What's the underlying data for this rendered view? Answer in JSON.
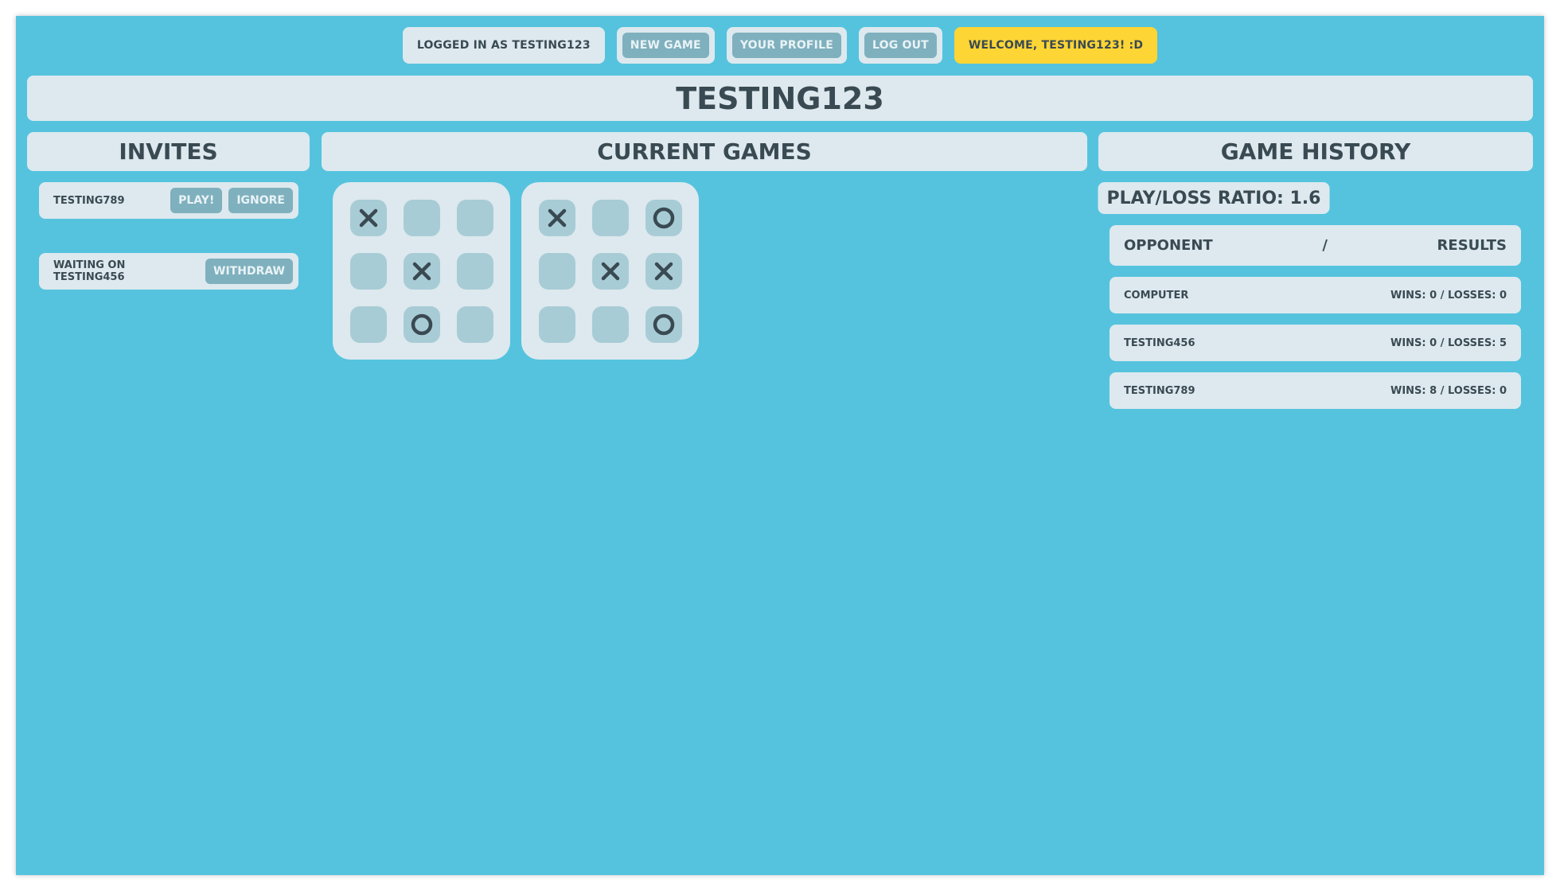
{
  "nav": {
    "logged_in": "LOGGED IN AS TESTING123",
    "new_game": "NEW GAME",
    "your_profile": "YOUR PROFILE",
    "log_out": "LOG OUT",
    "welcome": "WELCOME, TESTING123! :D"
  },
  "profile": {
    "title": "TESTING123"
  },
  "invites": {
    "heading": "INVITES",
    "items": [
      {
        "name": "TESTING789",
        "play": "PLAY!",
        "ignore": "IGNORE"
      },
      {
        "name": "WAITING ON TESTING456",
        "withdraw": "WITHDRAW"
      }
    ]
  },
  "current_games": {
    "heading": "CURRENT GAMES",
    "boards": [
      [
        "X",
        "",
        "",
        "",
        "X",
        "",
        "",
        "O",
        ""
      ],
      [
        "X",
        "",
        "O",
        "",
        "X",
        "X",
        "",
        "",
        "O"
      ]
    ]
  },
  "history": {
    "heading": "GAME HISTORY",
    "ratio": "PLAY/LOSS RATIO: 1.6",
    "col_opponent": "OPPONENT",
    "col_sep": "/",
    "col_results": "RESULTS",
    "rows": [
      {
        "opponent": "COMPUTER",
        "result": "WINS: 0 / LOSSES: 0"
      },
      {
        "opponent": "TESTING456",
        "result": "WINS: 0 / LOSSES: 5"
      },
      {
        "opponent": "TESTING789",
        "result": "WINS: 8 / LOSSES: 0"
      }
    ]
  },
  "colors": {
    "background": "#55c3de",
    "panel": "#dde9ee",
    "button": "#7fb0be",
    "cell": "#a8ccd6",
    "accent": "#fdd535",
    "text": "#3a4a52"
  }
}
